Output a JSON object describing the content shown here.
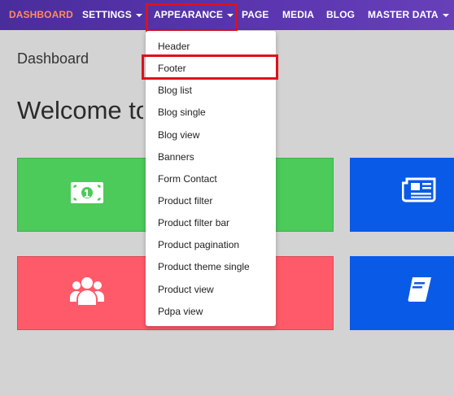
{
  "nav": {
    "items": [
      {
        "key": "dashboard",
        "label": "DASHBOARD",
        "caret": false,
        "active": true
      },
      {
        "key": "settings",
        "label": "SETTINGS",
        "caret": true,
        "active": false
      },
      {
        "key": "appearance",
        "label": "APPEARANCE",
        "caret": true,
        "active": false
      },
      {
        "key": "page",
        "label": "PAGE",
        "caret": false,
        "active": false
      },
      {
        "key": "media",
        "label": "MEDIA",
        "caret": false,
        "active": false
      },
      {
        "key": "blog",
        "label": "BLOG",
        "caret": false,
        "active": false
      },
      {
        "key": "master_data",
        "label": "MASTER DATA",
        "caret": true,
        "active": false
      }
    ]
  },
  "main": {
    "breadcrumb": "Dashboard",
    "welcome": "Welcome to"
  },
  "dropdown": {
    "items": [
      "Header",
      "Footer",
      "Blog list",
      "Blog single",
      "Blog view",
      "Banners",
      "Form Contact",
      "Product filter",
      "Product filter bar",
      "Product pagination",
      "Product theme single",
      "Product view",
      "Pdpa view"
    ]
  },
  "cards": [
    {
      "color": "green",
      "icon": "money-icon"
    },
    {
      "color": "blue",
      "icon": "newspaper-icon"
    },
    {
      "color": "red",
      "icon": "users-icon"
    },
    {
      "color": "blue",
      "icon": "book-icon"
    }
  ],
  "colors": {
    "navbar": "#5b36b0",
    "active_nav": "#ff8a65",
    "highlight": "#e0101a",
    "card_green": "#4cca5a",
    "card_red": "#ff5a6a",
    "card_blue": "#0a5ae8"
  }
}
